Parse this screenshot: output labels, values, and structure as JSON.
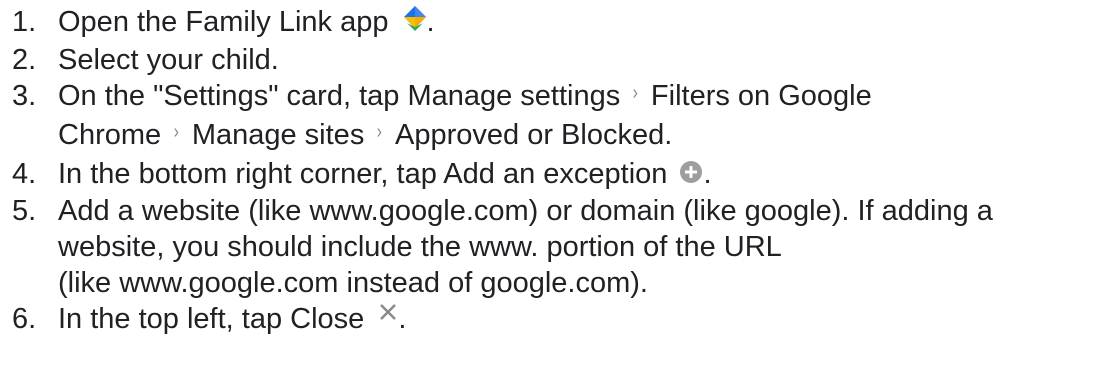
{
  "steps": [
    {
      "number": "1.",
      "parts": [
        "Open the Family Link app",
        "."
      ],
      "icon": "family-link-icon"
    },
    {
      "number": "2.",
      "text": "Select your child."
    },
    {
      "number": "3.",
      "line1": [
        "On the \"Settings\" card, tap Manage settings",
        "Filters on Google"
      ],
      "line2": [
        "Chrome",
        "Manage sites",
        "Approved or Blocked."
      ],
      "separator": "›"
    },
    {
      "number": "4.",
      "parts": [
        "In the bottom right corner, tap Add an exception",
        "."
      ],
      "icon": "add-circle-icon"
    },
    {
      "number": "5.",
      "lines": [
        "Add a website (like www.google.com) or domain (like google). If adding a",
        "website, you should include the www. portion of the URL",
        "(like www.google.com instead of google.com)."
      ]
    },
    {
      "number": "6.",
      "parts": [
        "In the top left, tap Close",
        "."
      ],
      "icon": "close-icon"
    }
  ]
}
